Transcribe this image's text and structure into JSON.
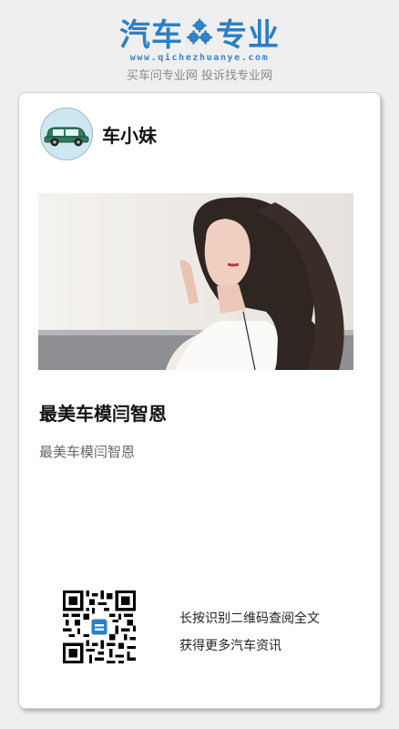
{
  "brand": {
    "logo_left": "汽车",
    "logo_right": "专业",
    "logo_icon": "gears-icon",
    "url": "www.qichezhuanye.com",
    "slogan": "买车问专业网 投诉找专业网",
    "color": "#2c80c4"
  },
  "card": {
    "author_name": "车小妹",
    "avatar_icon": "green-car-icon",
    "image_alt": "woman-portrait-photo",
    "title": "最美车模闫智恩",
    "summary": "最美车模闫智恩",
    "qr_lines": [
      "长按识别二维码查阅全文",
      "获得更多汽车资讯"
    ]
  }
}
